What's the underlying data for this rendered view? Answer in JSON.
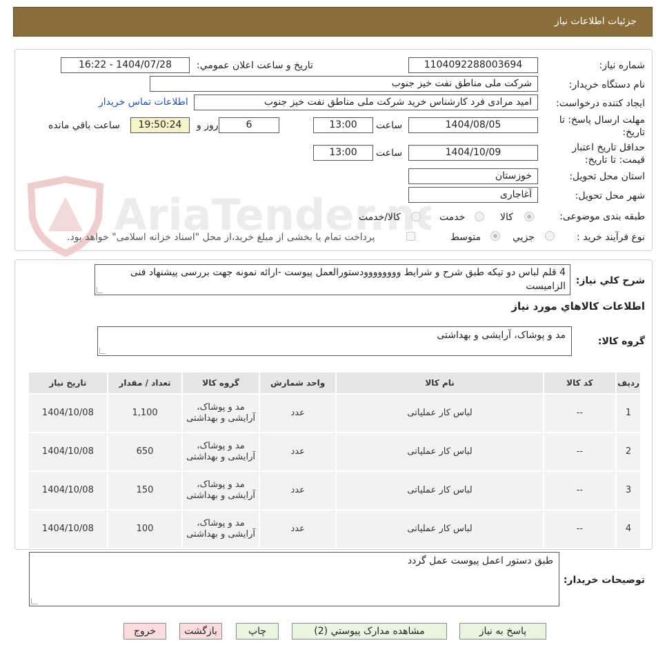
{
  "header": {
    "title": "جزئيات اطلاعات نياز"
  },
  "form": {
    "need_no_label": "شماره نياز:",
    "need_no": "1104092288003694",
    "announce_label": "تاريخ و ساعت اعلان عمومي:",
    "announce_value": "1404/07/28 - 16:22",
    "buyer_org_label": "نام دستگاه خريدار:",
    "buyer_org": "شرکت ملی مناطق نفت خیز جنوب",
    "creator_label": "ايجاد کننده درخواست:",
    "creator": "امید مرادی فرد کارشناس خرید شرکت ملی مناطق نفت خیز جنوب",
    "contact_link": "اطلاعات تماس خريدار",
    "deadline_label": "مهلت ارسال پاسخ: تا تاريخ:",
    "deadline_date": "1404/08/05",
    "time_label": "ساعت",
    "deadline_time": "13:00",
    "days": "6",
    "days_label": "روز و",
    "remaining_time": "19:50:24",
    "remaining_label": "ساعت باقي مانده",
    "validity_label": "حداقل تاريخ اعتبار قيمت: تا تاريخ:",
    "validity_date": "1404/10/09",
    "validity_time": "13:00",
    "province_label": "استان محل تحويل:",
    "province": "خوزستان",
    "city_label": "شهر محل تحويل:",
    "city": "آغاجاری",
    "category_label": "طبقه بندی موضوعی:",
    "category_options": [
      "کالا",
      "خدمت",
      "کالا/خدمت"
    ],
    "process_label": "نوع فرآيند خريد :",
    "process_options": [
      "جزيي",
      "متوسط"
    ],
    "payment_note": "پرداخت تمام یا بخشی از مبلغ خرید،از محل \"اسناد خزانه اسلامی\" خواهد بود."
  },
  "summary": {
    "label": "شرح کلي نياز:",
    "text": "4 قلم لباس دو تیکه طبق شرح و شرایط وووووووودستورالعمل پیوست -ارائه نمونه جهت بررسی پیشنهاد فنی الزامیست"
  },
  "items_section": {
    "title": "اطلاعات کالاهاي مورد نياز",
    "group_label": "گروه کالا:",
    "group_value": "مد و پوشاک، آرایشی و بهداشتی"
  },
  "table": {
    "headers": [
      "رديف",
      "کد کالا",
      "نام کالا",
      "واحد شمارش",
      "گروه کالا",
      "تعداد / مقدار",
      "تاريخ نياز"
    ],
    "rows": [
      [
        "1",
        "--",
        "لباس کار عملیاتی",
        "عدد",
        "مد و پوشاک، آرایشی و بهداشتی",
        "1,100",
        "1404/10/08"
      ],
      [
        "2",
        "--",
        "لباس کار عملیاتی",
        "عدد",
        "مد و پوشاک، آرایشی و بهداشتی",
        "650",
        "1404/10/08"
      ],
      [
        "3",
        "--",
        "لباس کار عملیاتی",
        "عدد",
        "مد و پوشاک، آرایشی و بهداشتی",
        "150",
        "1404/10/08"
      ],
      [
        "4",
        "--",
        "لباس کار عملیاتی",
        "عدد",
        "مد و پوشاک، آرایشی و بهداشتی",
        "100",
        "1404/10/08"
      ]
    ]
  },
  "buyer_notes": {
    "label": "توضيحات خريدار:",
    "text": "طبق دستور اعمل پیوست عمل گردد"
  },
  "buttons": {
    "reply": "پاسخ به نياز",
    "attachments": "مشاهده مدارک پيوستي (2)",
    "print": "چاپ",
    "back": "بازگشت",
    "exit": "خروج"
  },
  "watermark": {
    "text": "AriaTender.net"
  },
  "colors": {
    "header_bg": "#8a6d3b",
    "link": "#1a4fd1",
    "remaining_bg": "#f7f3c8",
    "button_green": "#e8f6e0",
    "button_pink": "#fbdcdc"
  }
}
